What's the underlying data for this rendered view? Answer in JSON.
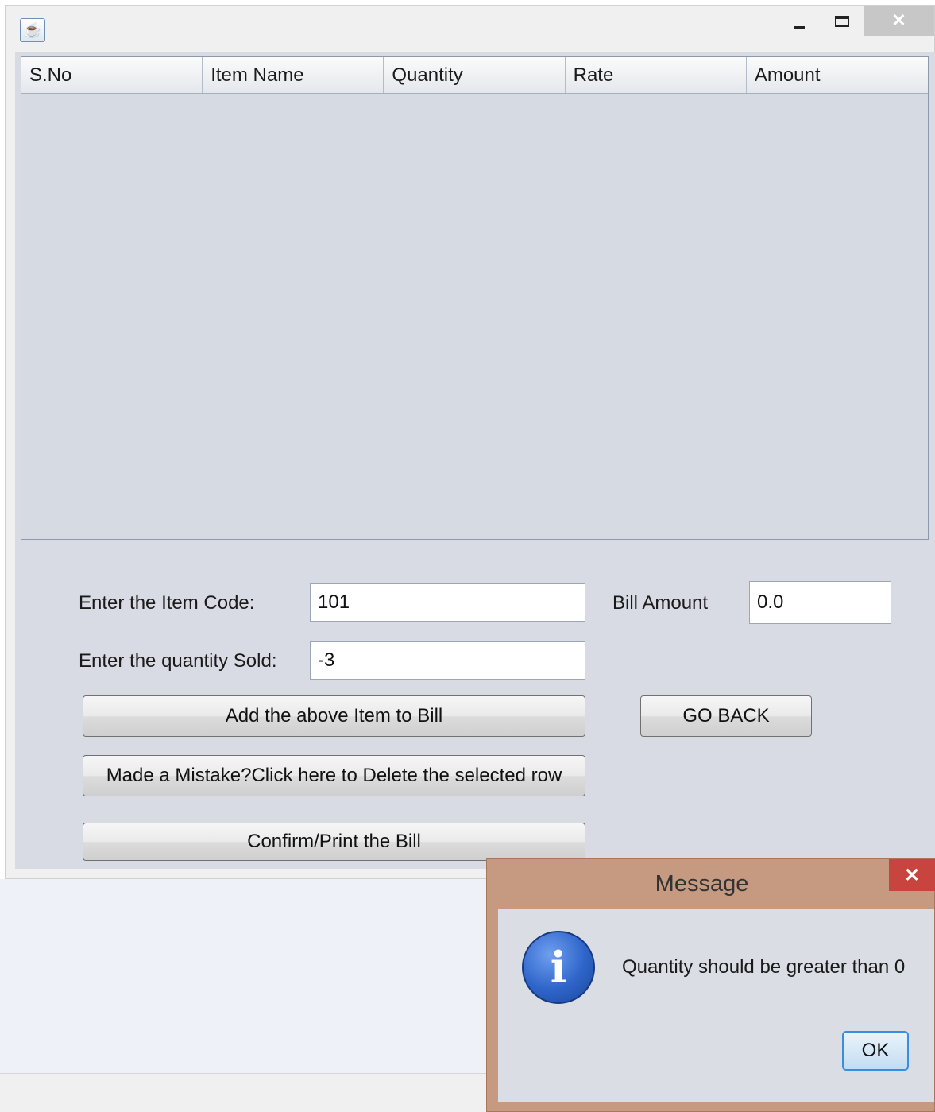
{
  "window": {
    "icon": "java-icon",
    "controls": {
      "minimize": "minimize-icon",
      "maximize": "maximize-icon",
      "close": "✕"
    }
  },
  "table": {
    "columns": [
      "S.No",
      "Item Name",
      "Quantity",
      "Rate",
      "Amount"
    ],
    "rows": []
  },
  "form": {
    "item_code_label": "Enter the Item Code:",
    "item_code_value": "101",
    "quantity_label": "Enter the quantity Sold:",
    "quantity_value": "-3",
    "bill_amount_label": "Bill Amount",
    "bill_amount_value": "0.0"
  },
  "buttons": {
    "add": "Add the above Item to Bill",
    "delete": "Made a Mistake?Click here to Delete the selected row",
    "confirm": "Confirm/Print the Bill",
    "go_back": "GO BACK"
  },
  "dialog": {
    "title": "Message",
    "close": "✕",
    "icon": "info-icon",
    "message": "Quantity should be greater than 0",
    "ok": "OK"
  },
  "colors": {
    "dialog_frame": "#c59a80",
    "dialog_close": "#c7443f",
    "info_icon": "#2e64c9",
    "ok_focus_border": "#3a8ee0"
  }
}
